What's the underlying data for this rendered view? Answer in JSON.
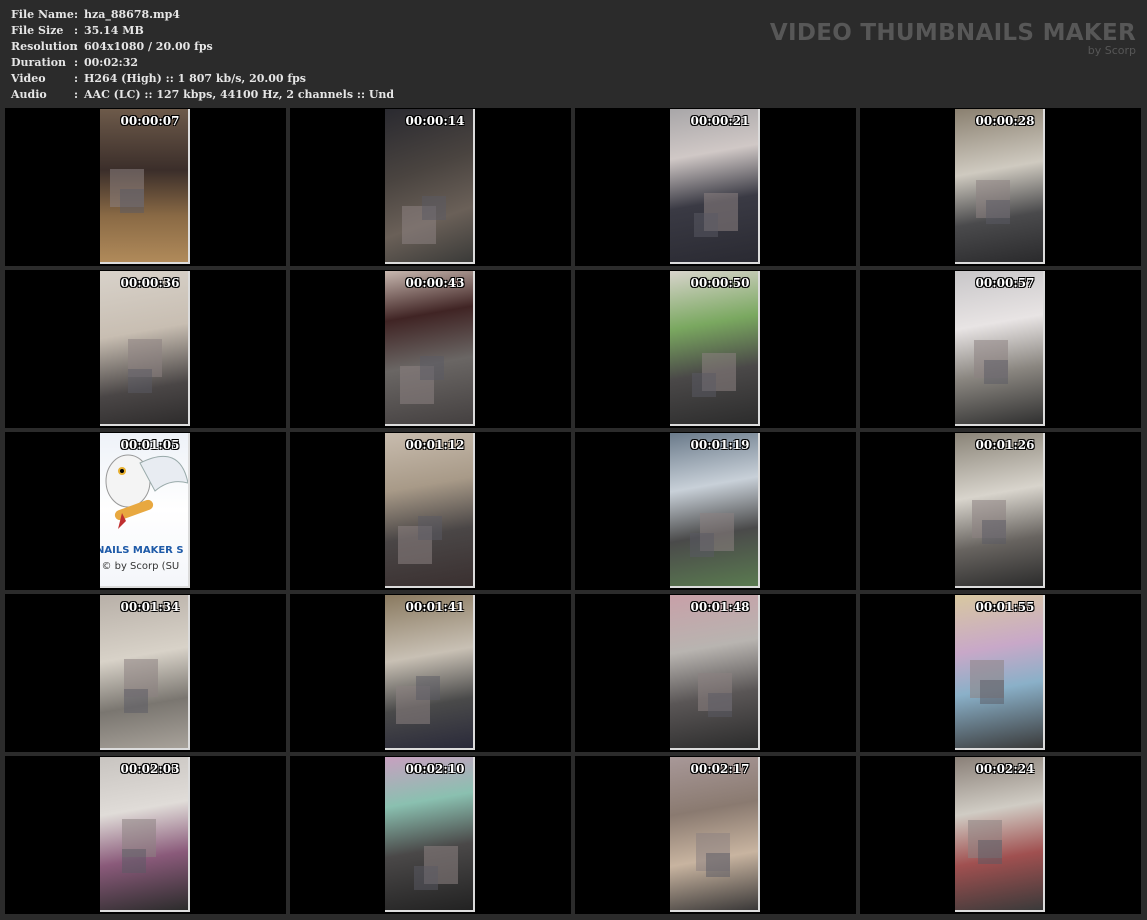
{
  "info": {
    "rows": [
      {
        "key": "File Name",
        "value": "hza_88678.mp4"
      },
      {
        "key": "File Size",
        "value": "35.14 MB"
      },
      {
        "key": "Resolution",
        "value": "604x1080 / 20.00 fps"
      },
      {
        "key": "Duration",
        "value": "00:02:32"
      },
      {
        "key": "Video",
        "value": "H264 (High) :: 1 807 kb/s, 20.00 fps"
      },
      {
        "key": "Audio",
        "value": "AAC (LC) :: 127 kbps, 44100 Hz, 2 channels :: Und"
      }
    ],
    "separator": ":"
  },
  "brand": {
    "title": "VIDEO THUMBNAILS MAKER",
    "subtitle": "by Scorp"
  },
  "owl_frame": {
    "line1": "HBNAILS MAKER S",
    "line2": "nt © by Scorp (SU"
  },
  "thumbnails": [
    {
      "time": "00:00:07",
      "bg": "linear-gradient(180deg,#6d5a4a 0%,#3b2e2a 40%,#8a6a45 70%,#b08a5a 100%)"
    },
    {
      "time": "00:00:14",
      "bg": "linear-gradient(160deg,#2a2a30 0%,#4a4440 40%,#6a6058 70%,#3a3a38 100%)"
    },
    {
      "time": "00:00:21",
      "bg": "linear-gradient(170deg,#a8a6a8 0%,#d0c8c6 30%,#3a3a44 60%,#2a2a32 100%)"
    },
    {
      "time": "00:00:28",
      "bg": "linear-gradient(170deg,#8a8070 0%,#cfcac0 40%,#4a4a4c 70%,#2a2a2c 100%)"
    },
    {
      "time": "00:00:36",
      "bg": "linear-gradient(170deg,#d8d2ca 0%,#c8beb2 40%,#4a4646 75%,#2e2c2c 100%)"
    },
    {
      "time": "00:00:43",
      "bg": "linear-gradient(170deg,#c8b8b0 0%,#402424 30%,#6a6664 60%,#444040 100%)"
    },
    {
      "time": "00:00:50",
      "bg": "linear-gradient(170deg,#d8d4cc 0%,#7aa860 35%,#4a4848 65%,#2c2c2c 100%)"
    },
    {
      "time": "00:00:57",
      "bg": "linear-gradient(170deg,#c8c6c8 0%,#e8e4e4 35%,#8a8680 65%,#303030 100%)"
    },
    {
      "time": "00:01:05",
      "bg": "linear-gradient(180deg,#eef2f8 0%,#ffffff 50%,#f4f6fa 100%)"
    },
    {
      "time": "00:01:12",
      "bg": "linear-gradient(170deg,#c8bcae 0%,#a89a88 35%,#4a4646 65%,#3a3030 100%)"
    },
    {
      "time": "00:01:19",
      "bg": "linear-gradient(170deg,#6a7a8a 0%,#c8d0d8 35%,#4a4a4a 65%,#5a7a50 100%)"
    },
    {
      "time": "00:01:26",
      "bg": "linear-gradient(170deg,#8a8478 0%,#d8d4cc 40%,#686460 70%,#2c2c2c 100%)"
    },
    {
      "time": "00:01:34",
      "bg": "linear-gradient(170deg,#b8b0a8 0%,#d8d2c8 40%,#7a7670 70%,#a8a29a 100%)"
    },
    {
      "time": "00:01:41",
      "bg": "linear-gradient(170deg,#8a7a60 0%,#c8c0b4 40%,#4a4a4a 70%,#2a2a3a 100%)"
    },
    {
      "time": "00:01:48",
      "bg": "linear-gradient(170deg,#c8a0a8 0%,#b8b4b0 35%,#5a5656 65%,#2c2c2c 100%)"
    },
    {
      "time": "00:01:55",
      "bg": "linear-gradient(170deg,#d8c8a0 0%,#c8a8c8 35%,#8ab0c8 60%,#3a3a3a 100%)"
    },
    {
      "time": "00:02:03",
      "bg": "linear-gradient(170deg,#c8c4c0 0%,#e0dcd8 35%,#8a5a7a 65%,#2c2c2c 100%)"
    },
    {
      "time": "00:02:10",
      "bg": "linear-gradient(170deg,#c8a0c0 0%,#8ac0b0 30%,#4a4848 60%,#222222 100%)"
    },
    {
      "time": "00:02:17",
      "bg": "linear-gradient(170deg,#a89898 0%,#8a7a70 35%,#c8b4a0 65%,#3a3838 100%)"
    },
    {
      "time": "00:02:24",
      "bg": "linear-gradient(170deg,#8a8078 0%,#d0ccc4 35%,#a05050 65%,#3a3a3a 100%)"
    }
  ]
}
